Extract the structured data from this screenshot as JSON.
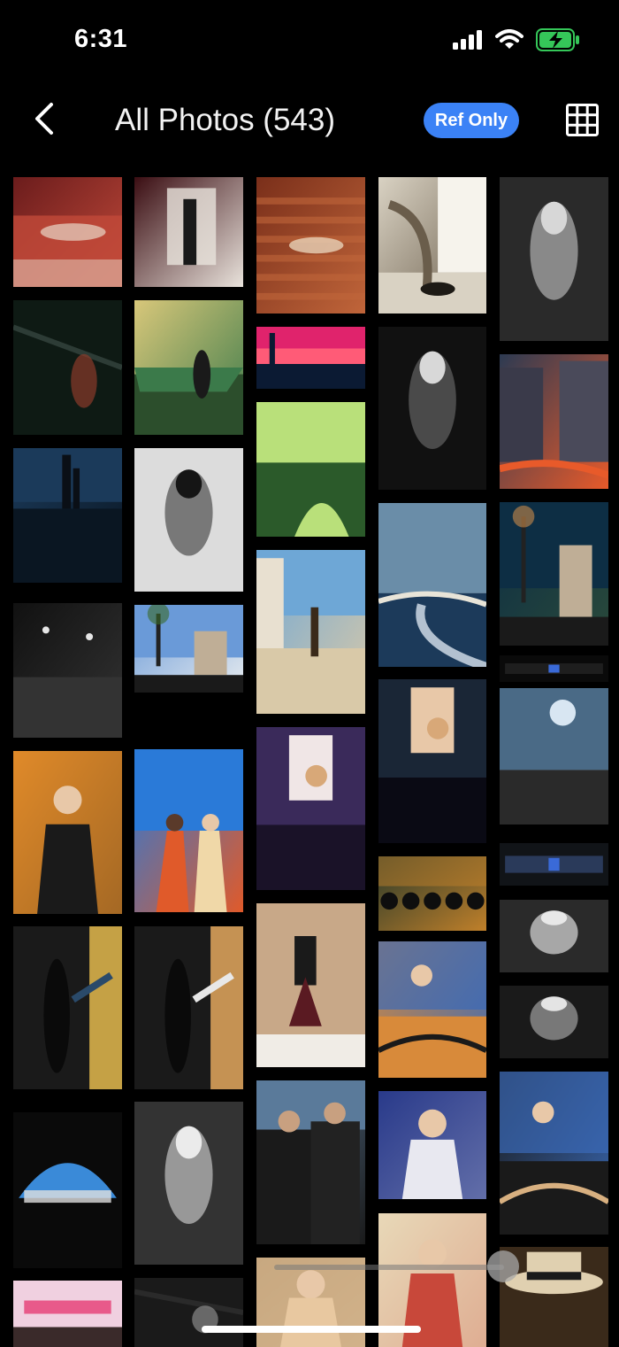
{
  "status_bar": {
    "time": "6:31"
  },
  "header": {
    "title": "All Photos (543)",
    "ref_only_label": "Ref Only"
  },
  "colors": {
    "accent": "#3b82f6",
    "background": "#000000",
    "battery": "#35c759"
  },
  "icons": [
    "chevron-left-icon",
    "grid-view-icon",
    "signal-icon",
    "wifi-icon",
    "battery-charging-icon"
  ],
  "photos": [
    {
      "id": "p1",
      "colors": [
        "#6b1c1c",
        "#c24a3a",
        "#e8d7c8"
      ],
      "overlay": {
        "type": "bands"
      }
    },
    {
      "id": "p2",
      "colors": [
        "#3a0d12",
        "#e9e3dc",
        "#1a1a1a"
      ],
      "overlay": {
        "type": "vdoor"
      }
    },
    {
      "id": "p3",
      "colors": [
        "#7a2f1a",
        "#c0653a",
        "#e9d2b8"
      ],
      "overlay": {
        "type": "stairs"
      }
    },
    {
      "id": "p4",
      "colors": [
        "#d9d2c3",
        "#6a5d4b",
        "#1d1a15"
      ],
      "overlay": {
        "type": "window"
      }
    },
    {
      "id": "p5",
      "colors": [
        "#2a2a2a",
        "#9a9a9a",
        "#e0e0e0"
      ],
      "overlay": {
        "type": "bw"
      }
    },
    {
      "id": "p6",
      "colors": [
        "#0e1a14",
        "#2d3c36",
        "#8a3a2a"
      ],
      "overlay": {
        "type": "dark"
      }
    },
    {
      "id": "p7",
      "colors": [
        "#d8c77a",
        "#3b7a4a",
        "#2c4e2c"
      ],
      "overlay": {
        "type": "boat"
      }
    },
    {
      "id": "p8",
      "colors": [
        "#e0236c",
        "#ff5b77",
        "#0b1a33"
      ],
      "overlay": {
        "type": "sunset"
      }
    },
    {
      "id": "p9",
      "colors": [
        "#111111",
        "#555555",
        "#e8e8e8"
      ],
      "overlay": {
        "type": "bw"
      }
    },
    {
      "id": "p10",
      "colors": [
        "#2c3a52",
        "#e85a2a",
        "#1a1a28"
      ],
      "overlay": {
        "type": "city"
      }
    },
    {
      "id": "p11",
      "colors": [
        "#1b3a5a",
        "#0a1622",
        "#e89a3a"
      ],
      "overlay": {
        "type": "skyline"
      }
    },
    {
      "id": "p12",
      "colors": [
        "#dcdcdc",
        "#666666",
        "#0a0a0a"
      ],
      "overlay": {
        "type": "bw"
      }
    },
    {
      "id": "p13",
      "colors": [
        "#b9e07a",
        "#2b5a2a",
        "#1d2c16"
      ],
      "overlay": {
        "type": "bridge"
      }
    },
    {
      "id": "p14",
      "colors": [
        "#6a8da8",
        "#e8e4d8",
        "#1c3a5a"
      ],
      "overlay": {
        "type": "wave"
      }
    },
    {
      "id": "p15",
      "colors": [
        "#0d2e44",
        "#2a4a3a",
        "#c98a4a"
      ],
      "overlay": {
        "type": "palms"
      }
    },
    {
      "id": "p16",
      "colors": [
        "#111111",
        "#333333",
        "#e6e6e6"
      ],
      "overlay": {
        "type": "road"
      }
    },
    {
      "id": "p17",
      "colors": [
        "#6a9ad8",
        "#e8ecef",
        "#3a6a2a"
      ],
      "overlay": {
        "type": "palms"
      }
    },
    {
      "id": "p18",
      "colors": [
        "#6ea7d6",
        "#d9c9a8",
        "#3a2a1a"
      ],
      "overlay": {
        "type": "street"
      }
    },
    {
      "id": "p19",
      "colors": [
        "#0a0a0a",
        "#1e1e1e",
        "#dddddd"
      ],
      "overlay": {
        "type": "screen"
      }
    },
    {
      "id": "p20",
      "colors": [
        "#4a6a86",
        "#d8e6f2",
        "#2a2a2a"
      ],
      "overlay": {
        "type": "sky"
      }
    },
    {
      "id": "p21",
      "colors": [
        "#e08a2a",
        "#1a1a1a",
        "#3a6ab8"
      ],
      "overlay": {
        "type": "person"
      }
    },
    {
      "id": "p22",
      "colors": [
        "#2a7ad8",
        "#e05a2a",
        "#f0d8a8"
      ],
      "overlay": {
        "type": "people"
      }
    },
    {
      "id": "p23",
      "colors": [
        "#3a2a5a",
        "#f0e6e6",
        "#1a1228"
      ],
      "overlay": {
        "type": "dj"
      }
    },
    {
      "id": "p24",
      "colors": [
        "#1a2636",
        "#e8c8a8",
        "#0a0a14"
      ],
      "overlay": {
        "type": "dj"
      }
    },
    {
      "id": "p25",
      "colors": [
        "#111418",
        "#2a3a5a",
        "#8aa0c8"
      ],
      "overlay": {
        "type": "screen"
      }
    },
    {
      "id": "p26",
      "colors": [
        "#2a3a2a",
        "#c0802a",
        "#0e0e0e"
      ],
      "overlay": {
        "type": "crowd"
      }
    },
    {
      "id": "p27",
      "colors": [
        "#1a1a1a",
        "#d8b04a",
        "#2a4a6a"
      ],
      "overlay": {
        "type": "darkdoor"
      }
    },
    {
      "id": "p28",
      "colors": [
        "#1a1a1a",
        "#d8a05a",
        "#e8e8e8"
      ],
      "overlay": {
        "type": "darkdoor"
      }
    },
    {
      "id": "p29",
      "colors": [
        "#c8a888",
        "#5a1a22",
        "#f0ece6"
      ],
      "overlay": {
        "type": "dancer"
      }
    },
    {
      "id": "p30",
      "colors": [
        "#d88a3a",
        "#3a6ab8",
        "#1a1a1a"
      ],
      "overlay": {
        "type": "bar"
      }
    },
    {
      "id": "p31",
      "colors": [
        "#2a2a2a",
        "#bdbdbd",
        "#f0f0f0"
      ],
      "overlay": {
        "type": "bw"
      }
    },
    {
      "id": "p32",
      "colors": [
        "#1a1a1a",
        "#8a8a8a",
        "#f0f0f0"
      ],
      "overlay": {
        "type": "bw"
      }
    },
    {
      "id": "p33",
      "colors": [
        "#0a0a0a",
        "#3a8ad8",
        "#e0e0e0"
      ],
      "overlay": {
        "type": "arch"
      }
    },
    {
      "id": "p34",
      "colors": [
        "#333333",
        "#aaaaaa",
        "#f4f4f4"
      ],
      "overlay": {
        "type": "bw"
      }
    },
    {
      "id": "p35",
      "colors": [
        "#5a7a9a",
        "#1a1a1a",
        "#c8a060"
      ],
      "overlay": {
        "type": "backs"
      }
    },
    {
      "id": "p36",
      "colors": [
        "#2a3a8a",
        "#e8e8f0",
        "#c8306a"
      ],
      "overlay": {
        "type": "person"
      }
    },
    {
      "id": "p37",
      "colors": [
        "#1a1a1a",
        "#3a6ab8",
        "#d8b080"
      ],
      "overlay": {
        "type": "bar"
      }
    },
    {
      "id": "p38",
      "colors": [
        "#e85a8a",
        "#f0d0e0",
        "#3a2a2a"
      ],
      "overlay": {
        "type": "pink"
      }
    },
    {
      "id": "p39",
      "colors": [
        "#1a1a1a",
        "#2a2a2a",
        "#8a8a8a"
      ],
      "overlay": {
        "type": "dark"
      }
    },
    {
      "id": "p40",
      "colors": [
        "#c8a880",
        "#e8c8a0",
        "#1a1a1a"
      ],
      "overlay": {
        "type": "person"
      }
    },
    {
      "id": "p41",
      "colors": [
        "#e8d8b8",
        "#c8483a",
        "#2a2a2a"
      ],
      "overlay": {
        "type": "person"
      }
    },
    {
      "id": "p42",
      "colors": [
        "#3a2a1a",
        "#e0d0b0",
        "#1a1a1a"
      ],
      "overlay": {
        "type": "hat"
      }
    }
  ]
}
